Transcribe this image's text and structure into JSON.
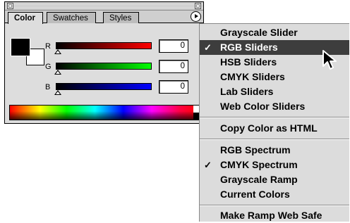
{
  "palette": {
    "tabs": [
      "Color",
      "Swatches",
      "Styles"
    ],
    "channels": [
      {
        "label": "R",
        "value": "0"
      },
      {
        "label": "G",
        "value": "0"
      },
      {
        "label": "B",
        "value": "0"
      }
    ],
    "colors": {
      "foreground": "#000000",
      "background": "#ffffff",
      "r_end": "#ff0000",
      "g_end": "#00ff00",
      "b_end": "#0000ff"
    }
  },
  "menu": {
    "items": [
      {
        "label": "Grayscale Slider",
        "checked": false,
        "selected": false
      },
      {
        "label": "RGB Sliders",
        "checked": true,
        "selected": true
      },
      {
        "label": "HSB Sliders",
        "checked": false,
        "selected": false
      },
      {
        "label": "CMYK Sliders",
        "checked": false,
        "selected": false
      },
      {
        "label": "Lab Sliders",
        "checked": false,
        "selected": false
      },
      {
        "label": "Web Color Sliders",
        "checked": false,
        "selected": false
      },
      {
        "label": "Copy Color as HTML",
        "checked": false,
        "selected": false
      },
      {
        "label": "RGB Spectrum",
        "checked": false,
        "selected": false
      },
      {
        "label": "CMYK Spectrum",
        "checked": true,
        "selected": false
      },
      {
        "label": "Grayscale Ramp",
        "checked": false,
        "selected": false
      },
      {
        "label": "Current Colors",
        "checked": false,
        "selected": false
      },
      {
        "label": "Make Ramp Web Safe",
        "checked": false,
        "selected": false
      }
    ],
    "check_glyph": "✓"
  }
}
